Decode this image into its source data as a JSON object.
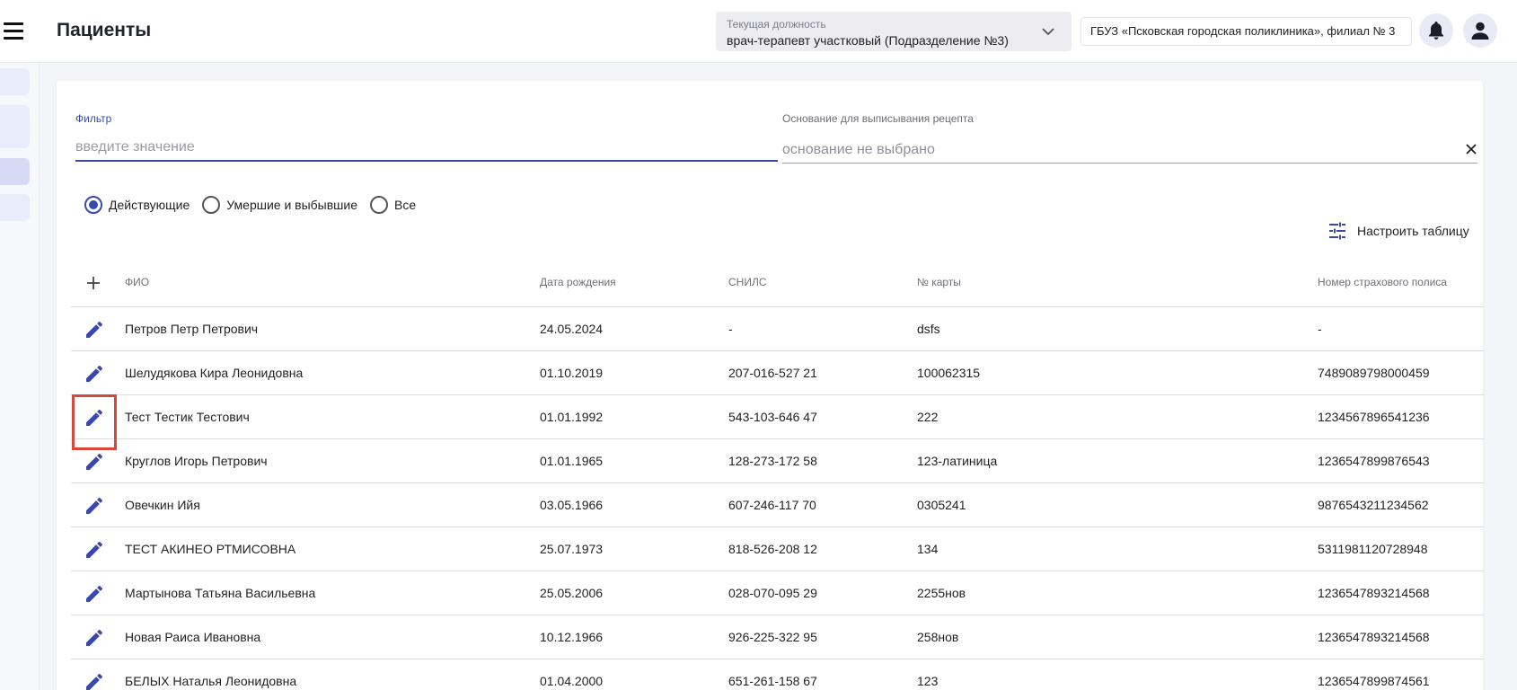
{
  "header": {
    "title": "Пациенты",
    "position": {
      "label": "Текущая должность",
      "value": "врач-терапевт участковый (Подразделение №3)"
    },
    "organization": "ГБУЗ «Псковская городская поликлиника», филиал № 3",
    "icons": {
      "menu": "menu-icon",
      "chevron": "chevron-down-icon",
      "bell": "bell-icon",
      "user": "user-icon"
    }
  },
  "filter": {
    "label": "Фильтр",
    "placeholder": "введите значение",
    "value": ""
  },
  "basis": {
    "label": "Основание для выписывания рецепта",
    "placeholder": "основание не выбрано"
  },
  "radios": [
    {
      "label": "Действующие",
      "checked": true
    },
    {
      "label": "Умершие и выбывшие",
      "checked": false
    },
    {
      "label": "Все",
      "checked": false
    }
  ],
  "configure_table_label": "Настроить таблицу",
  "table": {
    "headers": {
      "name": "ФИО",
      "birth": "Дата рождения",
      "snils": "СНИЛС",
      "card": "№ карты",
      "policy": "Номер страхового полиса"
    },
    "rows": [
      {
        "name": "Петров Петр Петрович",
        "birth": "24.05.2024",
        "snils": "-",
        "card": "dsfs",
        "policy": "-"
      },
      {
        "name": "Шелудякова Кира Леонидовна",
        "birth": "01.10.2019",
        "snils": "207-016-527 21",
        "card": "100062315",
        "policy": "7489089798000459"
      },
      {
        "name": "Тест Тестик Тестович",
        "birth": "01.01.1992",
        "snils": "543-103-646 47",
        "card": "222",
        "policy": "1234567896541236"
      },
      {
        "name": "Круглов Игорь Петрович",
        "birth": "01.01.1965",
        "snils": "128-273-172 58",
        "card": "123-латиница",
        "policy": "1236547899876543"
      },
      {
        "name": "Овечкин Ийя",
        "birth": "03.05.1966",
        "snils": "607-246-117 70",
        "card": "0305241",
        "policy": "9876543211234562"
      },
      {
        "name": "ТЕСТ АКИНЕО РТМИСОВНА",
        "birth": "25.07.1973",
        "snils": "818-526-208 12",
        "card": "134",
        "policy": "5311981120728948"
      },
      {
        "name": "Мартынова Татьяна Васильевна",
        "birth": "25.05.2006",
        "snils": "028-070-095 29",
        "card": "2255нов",
        "policy": "1236547893214568"
      },
      {
        "name": "Новая Раиса Ивановна",
        "birth": "10.12.1966",
        "snils": "926-225-322 95",
        "card": "258нов",
        "policy": "1236547893214568"
      },
      {
        "name": "БЕЛЫХ Наталья Леонидовна",
        "birth": "01.04.2000",
        "snils": "651-261-158 67",
        "card": "123",
        "policy": "1236547899874561"
      }
    ]
  },
  "colors": {
    "accent": "#3949ab",
    "highlight": "#d9473b"
  }
}
